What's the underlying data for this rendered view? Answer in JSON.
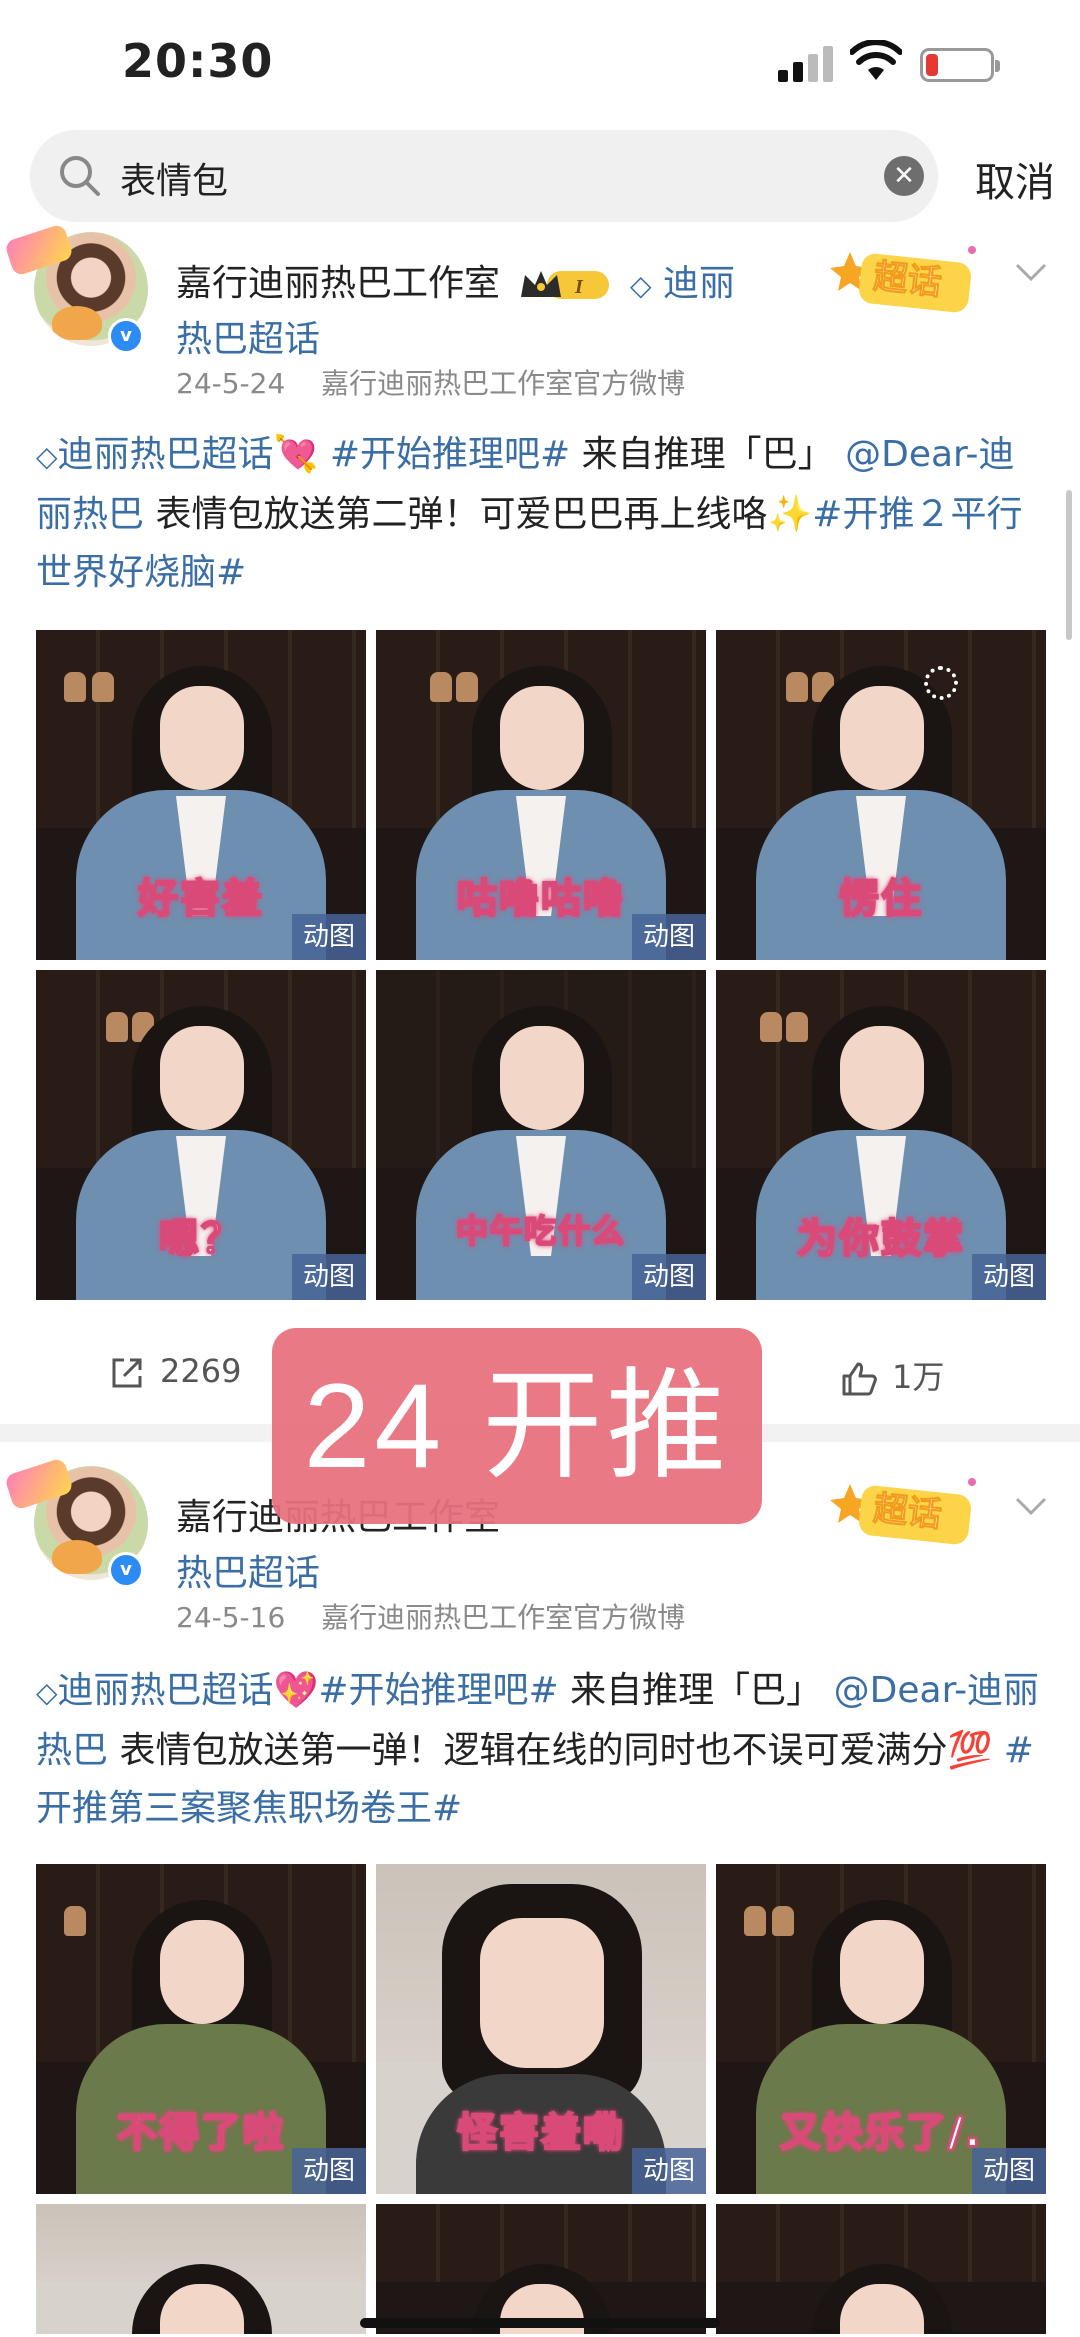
{
  "status_bar": {
    "time": "20:30"
  },
  "search": {
    "query": "表情包",
    "cancel_label": "取消"
  },
  "posts": [
    {
      "author": "嘉行迪丽热巴工作室",
      "super_link_line1": "迪丽",
      "super_link_line2": "热巴超话",
      "date": "24-5-24",
      "source": "嘉行迪丽热巴工作室官方微博",
      "chaohua_label": "超话",
      "text_parts": [
        "迪丽热巴超话",
        "💘",
        "#开始推理吧#",
        " 来自推理「巴」",
        "@Dear-迪丽热巴",
        " 表情包放送第二弹！可爱巴巴再上线咯",
        "✨",
        "#开推２平行世界好烧脑#"
      ],
      "images": [
        {
          "caption": "好害羞",
          "tag": "动图"
        },
        {
          "caption": "咕噜咕噜",
          "tag": "动图"
        },
        {
          "caption": "愣住",
          "tag": ""
        },
        {
          "caption": "嗯？",
          "tag": "动图"
        },
        {
          "caption": "中午吃什么",
          "tag": "动图"
        },
        {
          "caption": "为你鼓掌",
          "tag": "动图"
        }
      ],
      "share_count": "2269",
      "like_count": "1万"
    },
    {
      "author": "嘉行迪丽热巴工作室",
      "super_link_line2": "热巴超话",
      "date": "24-5-16",
      "source": "嘉行迪丽热巴工作室官方微博",
      "chaohua_label": "超话",
      "text_parts": [
        "迪丽热巴超话",
        "💖",
        "#开始推理吧#",
        " 来自推理「巴」",
        "@Dear-迪丽热巴",
        " 表情包放送第一弹！逻辑在线的同时也不误可爱满分",
        "💯",
        "#开推第三案聚焦职场卷王#"
      ],
      "images": [
        {
          "caption": "不得了啦",
          "tag": "动图"
        },
        {
          "caption": "怪害羞嘞",
          "tag": "动图"
        },
        {
          "caption": "又快乐了/.",
          "tag": "动图"
        }
      ]
    }
  ],
  "overlay_sticker": {
    "text": "24 开推"
  },
  "colors": {
    "link": "#3a6ea5",
    "sticker": "#e8717e",
    "gif_tag": "#4664a0"
  }
}
